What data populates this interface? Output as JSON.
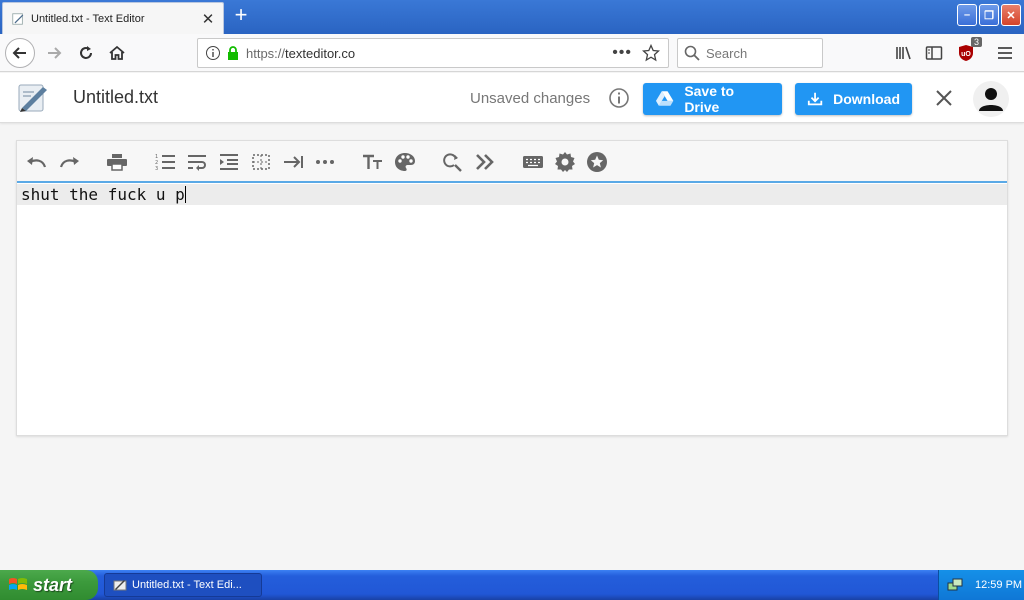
{
  "browser": {
    "tab": {
      "title": "Untitled.txt - Text Editor"
    },
    "url": {
      "protocol": "https://",
      "host": "texteditor.co"
    },
    "search": {
      "placeholder": "Search"
    },
    "ublock_badge": "3"
  },
  "app": {
    "doc_name": "Untitled.txt",
    "status": "Unsaved changes",
    "save_drive_label": "Save to Drive",
    "download_label": "Download",
    "accent": "#2196f3"
  },
  "editor": {
    "text": "shut the fuck u p"
  },
  "taskbar": {
    "start_label": "start",
    "task_label": "Untitled.txt - Text Edi...",
    "clock": "12:59 PM"
  }
}
